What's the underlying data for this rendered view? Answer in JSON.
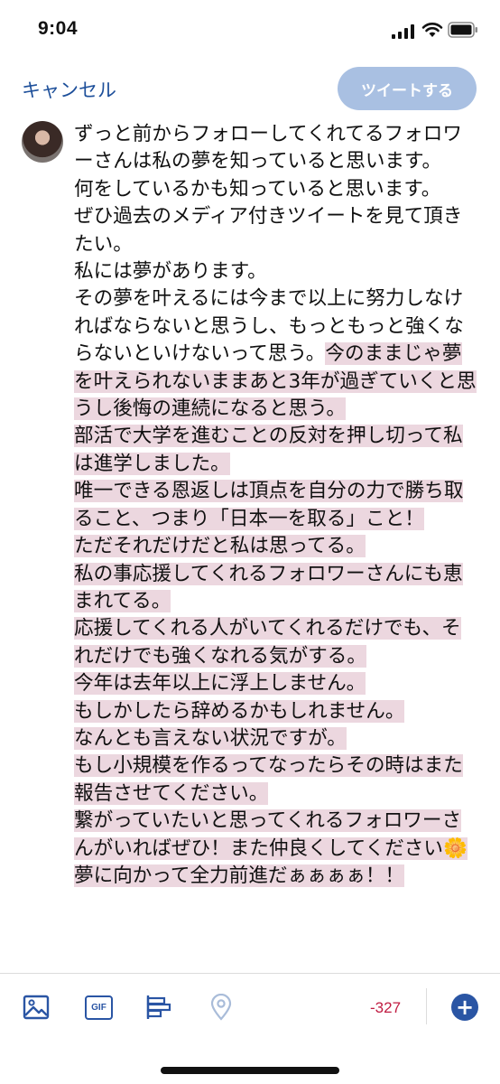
{
  "status_bar": {
    "time": "9:04"
  },
  "header": {
    "cancel_label": "キャンセル",
    "tweet_label": "ツイートする"
  },
  "compose": {
    "avatar_icon": "user-avatar",
    "text_plain": "ずっと前からフォローしてくれてるフォロワーさんは私の夢を知っていると思います。\n何をしているかも知っていると思います。\nぜひ過去のメディア付きツイートを見て頂きたい。\n私には夢があります。\nその夢を叶えるには今まで以上に努力しなければならないと思うし、もっともっと強くならないといけないって思う。",
    "text_highlighted": "今のままじゃ夢を叶えられないままあと3年が過ぎていくと思うし後悔の連続になると思う。\n部活で大学を進むことの反対を押し切って私は進学しました。\n唯一できる恩返しは頂点を自分の力で勝ち取ること、つまり「日本一を取る」こと！\nただそれだけだと私は思ってる。\n私の事応援してくれるフォロワーさんにも恵まれてる。\n応援してくれる人がいてくれるだけでも、それだけでも強くなれる気がする。\n今年は去年以上に浮上しません。\nもしかしたら辞めるかもしれません。\nなんとも言えない状況ですが。\nもし小規模を作るってなったらその時はまた報告させてください。\n繋がっていたいと思ってくれるフォロワーさんがいればぜひ！また仲良くしてください🌼\n夢に向かって全力前進だぁぁぁぁ！！",
    "highlight_color": "#ecd7df"
  },
  "toolbar": {
    "icons": [
      "image-icon",
      "gif-icon",
      "poll-icon",
      "location-icon",
      "add-icon"
    ],
    "gif_label": "GIF",
    "char_count": "-327",
    "add_label": "+",
    "accent": "#2a55a4",
    "over_limit_color": "#c01c42"
  }
}
